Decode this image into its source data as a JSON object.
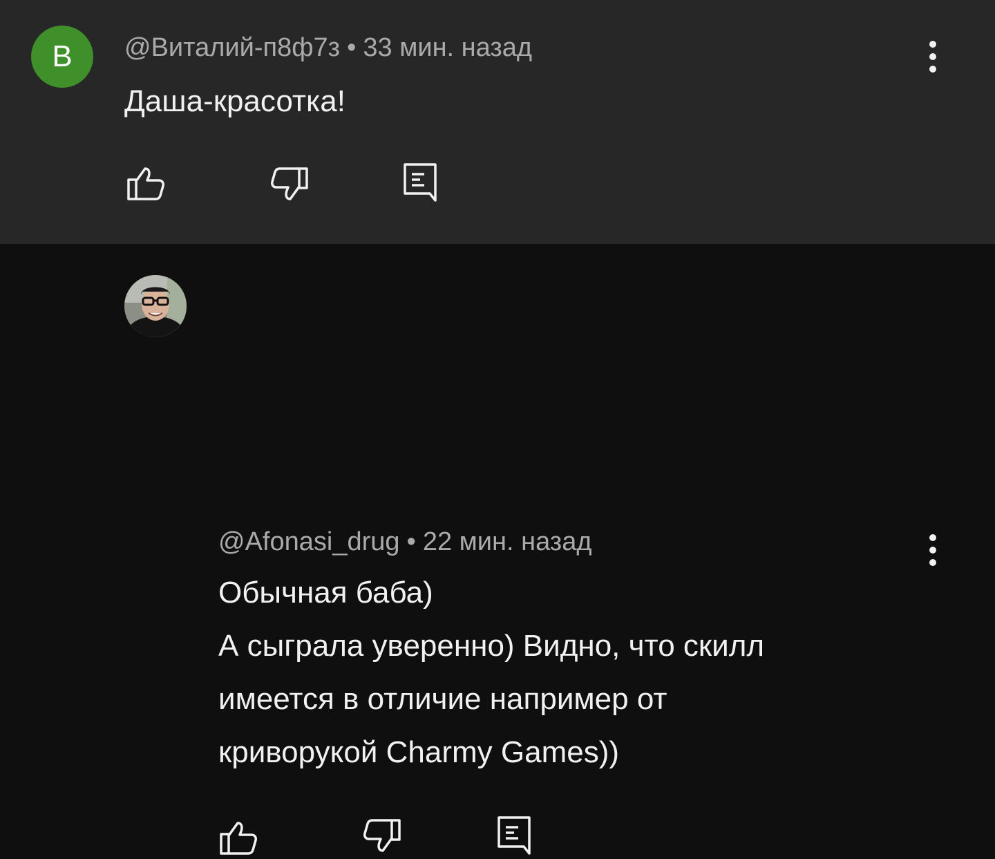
{
  "comments": [
    {
      "avatar_letter": "В",
      "avatar_color": "#3f8f2a",
      "author": "@Виталий-п8ф7з",
      "separator": "•",
      "time": "33 мин. назад",
      "lines": [
        "Даша-красотка!"
      ],
      "actions": [
        "like-icon",
        "dislike-icon",
        "reply-icon"
      ],
      "more_icon": "more-vertical-icon"
    },
    {
      "avatar_type": "photo",
      "author": "@Afonasi_drug",
      "separator": "•",
      "time": "22 мин. назад",
      "lines": [
        "Обычная баба)",
        "А сыграла уверенно) Видно, что скилл",
        "имеется в отличие например от",
        "криворукой Charmy Games))"
      ],
      "actions": [
        "like-icon",
        "dislike-icon",
        "reply-icon"
      ],
      "more_icon": "more-vertical-icon"
    }
  ],
  "colors": {
    "top_background": "#272727",
    "page_background": "#0f0f0f",
    "text": "#f1f1f1",
    "meta_text": "#aaaaaa"
  }
}
